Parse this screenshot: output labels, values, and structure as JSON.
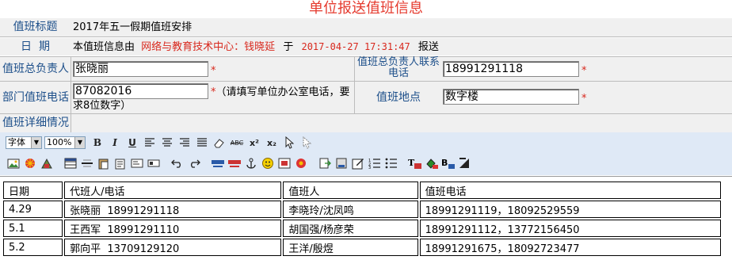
{
  "page_title": "单位报送值班信息",
  "form": {
    "title_label": "值班标题",
    "title_value": "2017年五一假期值班安排",
    "date_label": "日  期",
    "date_prefix": "本值班信息由",
    "date_unit": "网络与教育技术中心：钱晓延",
    "date_mid": "于",
    "date_time": "2017-04-27 17:31:47",
    "date_suffix": "报送",
    "chief_label": "值班总负责人",
    "chief_value": "张晓丽",
    "chief_phone_label": "值班总负责人联系电话",
    "chief_phone_value": "18991291118",
    "dept_phone_label": "部门值班电话",
    "dept_phone_value": "87082016",
    "dept_phone_hint": "（请填写单位办公室电话，要求8位数字）",
    "location_label": "值班地点",
    "location_value": "数字楼",
    "details_label": "值班详细情况",
    "required_mark": "*"
  },
  "toolbar": {
    "font_select": "字体",
    "zoom_select": "100%",
    "row1": [
      "bold-icon",
      "italic-icon",
      "underline-icon",
      "align-left-icon",
      "align-center-icon",
      "align-right-icon",
      "align-justify-icon",
      "eraser-icon",
      "strikethrough-icon",
      "superscript-icon",
      "subscript-icon",
      "pointer-icon",
      "select-icon"
    ],
    "row2": [
      "image-icon",
      "flash-icon",
      "media-icon",
      "table-icon",
      "hr-icon",
      "paste-icon",
      "paste-text-icon",
      "form-icon",
      "undo-icon",
      "redo-icon",
      "link-icon",
      "unlink-icon",
      "anchor-icon",
      "emoticon-icon",
      "special-char-icon",
      "sign-icon",
      "import-icon",
      "export-icon",
      "edit-icon",
      "ordered-list-icon",
      "unordered-list-icon",
      "font-color-icon",
      "bg-color-icon",
      "bold-color-icon",
      "clear-icon"
    ],
    "bold_glyph": "B",
    "italic_glyph": "I",
    "underline_glyph": "U",
    "sup_glyph": "x²",
    "sub_glyph": "x₂",
    "abc_glyph": "ABC"
  },
  "table": {
    "headers": [
      "日期",
      "代班人/电话",
      "值班人",
      "值班电话"
    ],
    "rows": [
      [
        "4.29",
        "张晓丽  18991291118",
        "李晓玲/沈凤鸣",
        "18991291119，18092529559"
      ],
      [
        "5.1",
        "王西军  18991291110",
        "胡国强/杨彦荣",
        "18991291112，13772156450"
      ],
      [
        "5.2",
        "郭向平  13709129120",
        "王洋/殷煜",
        "18991291675，18092723477"
      ]
    ]
  }
}
